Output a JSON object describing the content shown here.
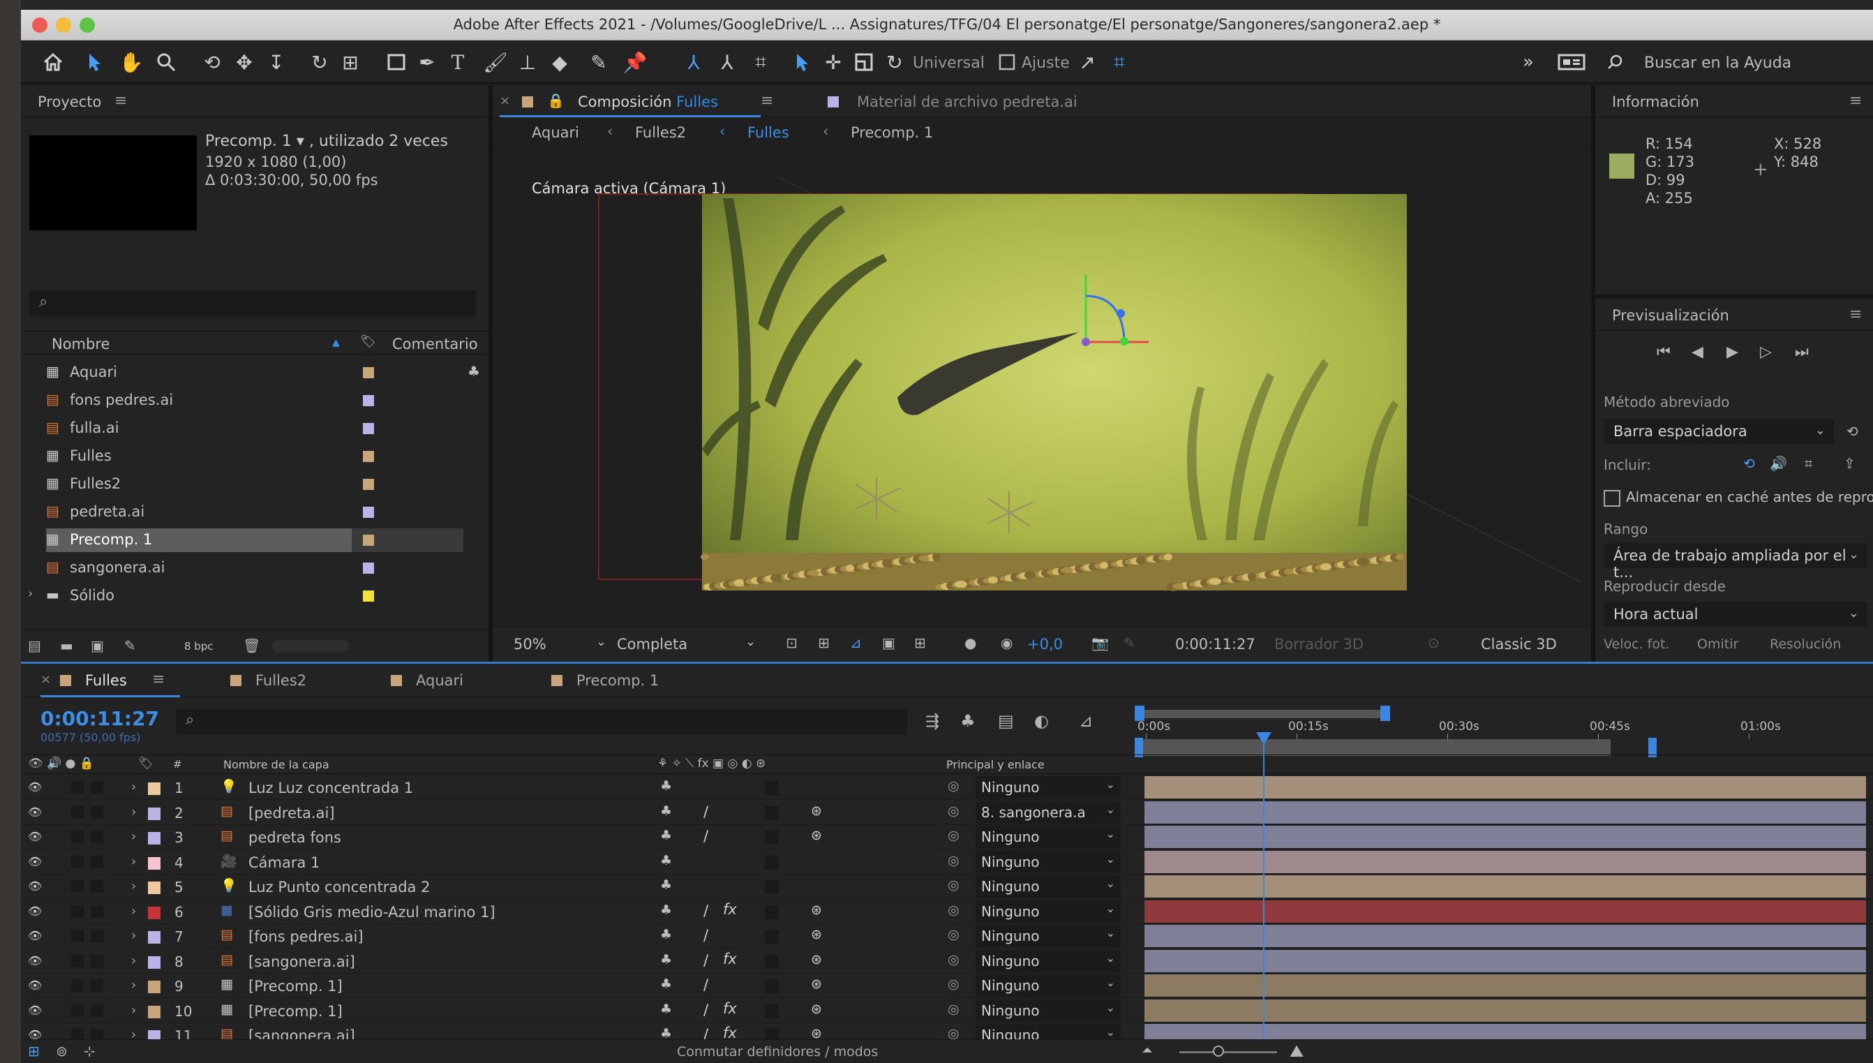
{
  "window": {
    "title": "Adobe After Effects 2021 - /Volumes/GoogleDrive/L ... Assignatures/TFG/04 El personatge/El personatge/Sangoneres/sangonera2.aep *"
  },
  "toolbar": {
    "universal_label": "Universal",
    "ajuste_label": "Ajuste",
    "search_placeholder": "Buscar en la Ayuda"
  },
  "project": {
    "panel_title": "Proyecto",
    "selected_name": "Precomp. 1 ▾ , utilizado 2 veces",
    "selected_dims": "1920 x 1080 (1,00)",
    "selected_duration": "Δ 0:03:30:00, 50,00 fps",
    "col_name": "Nombre",
    "col_comment": "Comentario",
    "items": [
      {
        "name": "Aquari",
        "kind": "comp",
        "color": "#c9a57b"
      },
      {
        "name": "fons pedres.ai",
        "kind": "ai",
        "color": "#b9b3e6"
      },
      {
        "name": "fulla.ai",
        "kind": "ai",
        "color": "#b9b3e6"
      },
      {
        "name": "Fulles",
        "kind": "comp",
        "color": "#c9a57b"
      },
      {
        "name": "Fulles2",
        "kind": "comp",
        "color": "#c9a57b"
      },
      {
        "name": "pedreta.ai",
        "kind": "ai",
        "color": "#b9b3e6"
      },
      {
        "name": "Precomp. 1",
        "kind": "comp",
        "color": "#c9a57b"
      },
      {
        "name": "sangonera.ai",
        "kind": "ai",
        "color": "#b9b3e6"
      },
      {
        "name": "Sólido",
        "kind": "folder",
        "color": "#f2e13a"
      }
    ],
    "bpc": "8 bpc"
  },
  "composition": {
    "tab_prefix": "Composición",
    "tab_name": "Fulles",
    "tab2": "Material de archivo pedreta.ai",
    "breadcrumbs": [
      "Aquari",
      "Fulles2",
      "Fulles",
      "Precomp. 1"
    ],
    "camera_label": "Cámara activa (Cámara 1)",
    "zoom": "50%",
    "quality": "Completa",
    "exposure": "+0,0",
    "timecode": "0:00:11:27",
    "draft3d": "Borrador 3D",
    "renderer": "Classic 3D"
  },
  "info": {
    "title": "Información",
    "r": "R:  154",
    "g": "G:  173",
    "b": "D:  99",
    "a": "A:  255",
    "x": "X:  528",
    "y": "Y:  848",
    "swatch_color": "#9aad63"
  },
  "preview": {
    "title": "Previsualización",
    "shortcut_label": "Método abreviado",
    "shortcut_value": "Barra espaciadora",
    "include_label": "Incluir:",
    "cache_label": "Almacenar en caché antes de reprodu",
    "range_label": "Rango",
    "range_value": "Área de trabajo ampliada por el t...",
    "play_from_label": "Reproducir desde",
    "play_from_value": "Hora actual",
    "fps_label": "Veloc. fot.",
    "skip_label": "Omitir",
    "res_label": "Resolución"
  },
  "timeline": {
    "tabs": [
      "Fulles",
      "Fulles2",
      "Aquari",
      "Precomp. 1"
    ],
    "timecode": "0:00:11:27",
    "frames": "00577 (50,00 fps)",
    "col_layer_name": "Nombre de la capa",
    "col_parent": "Principal y enlace",
    "ruler": [
      "0:00s",
      "00:15s",
      "00:30s",
      "00:45s",
      "01:00s"
    ],
    "layers": [
      {
        "num": "1",
        "name": "Luz Luz concentrada 1",
        "label": "#f0c8a0",
        "icon": "light",
        "parent": "Ninguno",
        "bar": "#a48f7a",
        "sw": "",
        "fx": false,
        "cube": false
      },
      {
        "num": "2",
        "name": "[pedreta.ai]",
        "label": "#b9b3e6",
        "icon": "ai",
        "parent": "8. sangonera.a",
        "bar": "#7f7f98",
        "sw": "/",
        "fx": false,
        "cube": true
      },
      {
        "num": "3",
        "name": "pedreta fons",
        "label": "#b9b3e6",
        "icon": "ai",
        "parent": "Ninguno",
        "bar": "#7f7f98",
        "sw": "/",
        "fx": false,
        "cube": true
      },
      {
        "num": "4",
        "name": "Cámara 1",
        "label": "#f5c4cf",
        "icon": "camera",
        "parent": "Ninguno",
        "bar": "#9e8a8c",
        "sw": "",
        "fx": false,
        "cube": false
      },
      {
        "num": "5",
        "name": "Luz Punto concentrada 2",
        "label": "#f0c8a0",
        "icon": "light",
        "parent": "Ninguno",
        "bar": "#a48f7a",
        "sw": "",
        "fx": false,
        "cube": false
      },
      {
        "num": "6",
        "name": "[Sólido Gris medio-Azul marino 1]",
        "label": "#c8333a",
        "icon": "solid",
        "parent": "Ninguno",
        "bar": "#8f3a3c",
        "sw": "/",
        "fx": true,
        "cube": true
      },
      {
        "num": "7",
        "name": "[fons pedres.ai]",
        "label": "#b9b3e6",
        "icon": "ai",
        "parent": "Ninguno",
        "bar": "#7f7f98",
        "sw": "/",
        "fx": false,
        "cube": true
      },
      {
        "num": "8",
        "name": "[sangonera.ai]",
        "label": "#b9b3e6",
        "icon": "ai",
        "parent": "Ninguno",
        "bar": "#7f7f98",
        "sw": "/",
        "fx": true,
        "cube": true
      },
      {
        "num": "9",
        "name": "[Precomp. 1]",
        "label": "#c9a57b",
        "icon": "comp",
        "parent": "Ninguno",
        "bar": "#8c7a62",
        "sw": "/",
        "fx": false,
        "cube": true
      },
      {
        "num": "10",
        "name": "[Precomp. 1]",
        "label": "#c9a57b",
        "icon": "comp",
        "parent": "Ninguno",
        "bar": "#8c7a62",
        "sw": "/",
        "fx": true,
        "cube": true
      },
      {
        "num": "11",
        "name": "[sangonera.ai]",
        "label": "#b9b3e6",
        "icon": "ai",
        "parent": "Ninguno",
        "bar": "#7f7f98",
        "sw": "/",
        "fx": true,
        "cube": true
      }
    ],
    "footer_label": "Conmutar definidores / modos"
  }
}
